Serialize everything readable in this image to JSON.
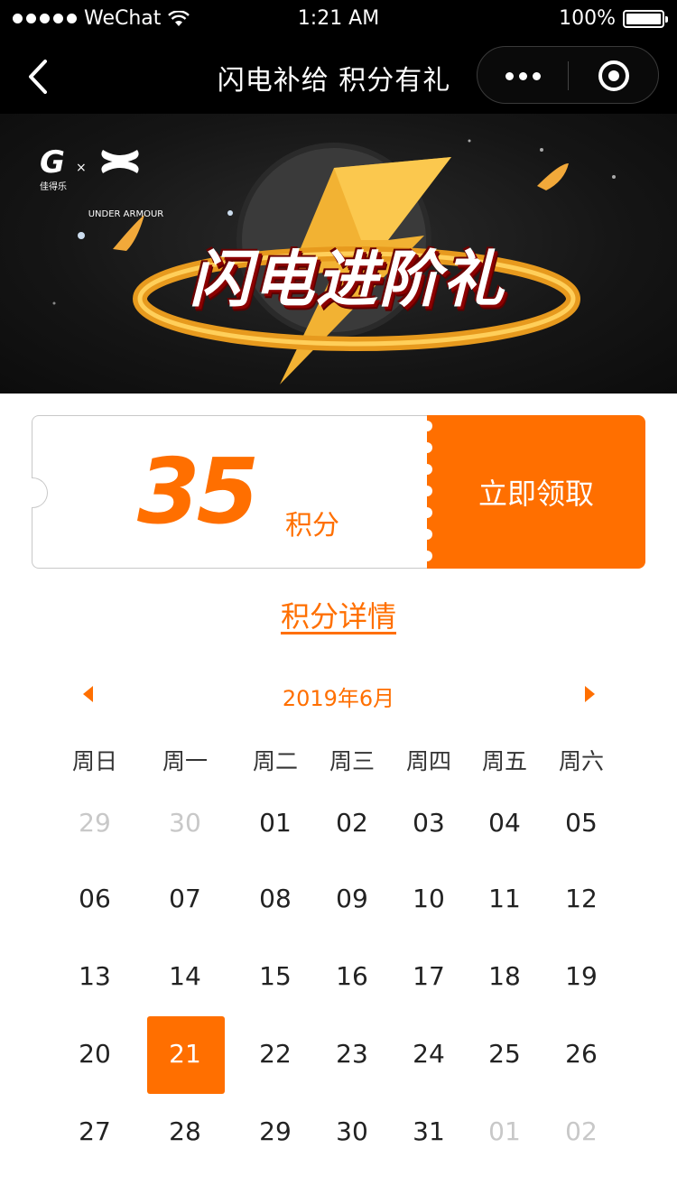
{
  "status_bar": {
    "carrier": "WeChat",
    "time": "1:21 AM",
    "battery": "100%"
  },
  "nav": {
    "title": "闪电补给 积分有礼"
  },
  "banner": {
    "brand_g_sub": "佳得乐",
    "brand_x": "×",
    "brand_ua": "UNDER ARMOUR",
    "headline": "闪电进阶礼"
  },
  "coupon": {
    "points": "35",
    "points_unit": "积分",
    "claim_button": "立即领取"
  },
  "detail_link": "积分详情",
  "calendar": {
    "month_label": "2019年6月",
    "weekdays": [
      "周日",
      "周一",
      "周二",
      "周三",
      "周四",
      "周五",
      "周六"
    ],
    "weeks": [
      [
        "29",
        "30",
        "01",
        "02",
        "03",
        "04",
        "05"
      ],
      [
        "06",
        "07",
        "08",
        "09",
        "10",
        "11",
        "12"
      ],
      [
        "13",
        "14",
        "15",
        "16",
        "17",
        "18",
        "19"
      ],
      [
        "20",
        "21",
        "22",
        "23",
        "24",
        "25",
        "26"
      ],
      [
        "27",
        "28",
        "29",
        "30",
        "31",
        "01",
        "02"
      ]
    ],
    "muted": [
      [
        0,
        0
      ],
      [
        0,
        1
      ],
      [
        4,
        5
      ],
      [
        4,
        6
      ]
    ],
    "selected": [
      3,
      1
    ]
  },
  "colors": {
    "accent": "#ff6f00",
    "muted": "#c8c8c8"
  }
}
